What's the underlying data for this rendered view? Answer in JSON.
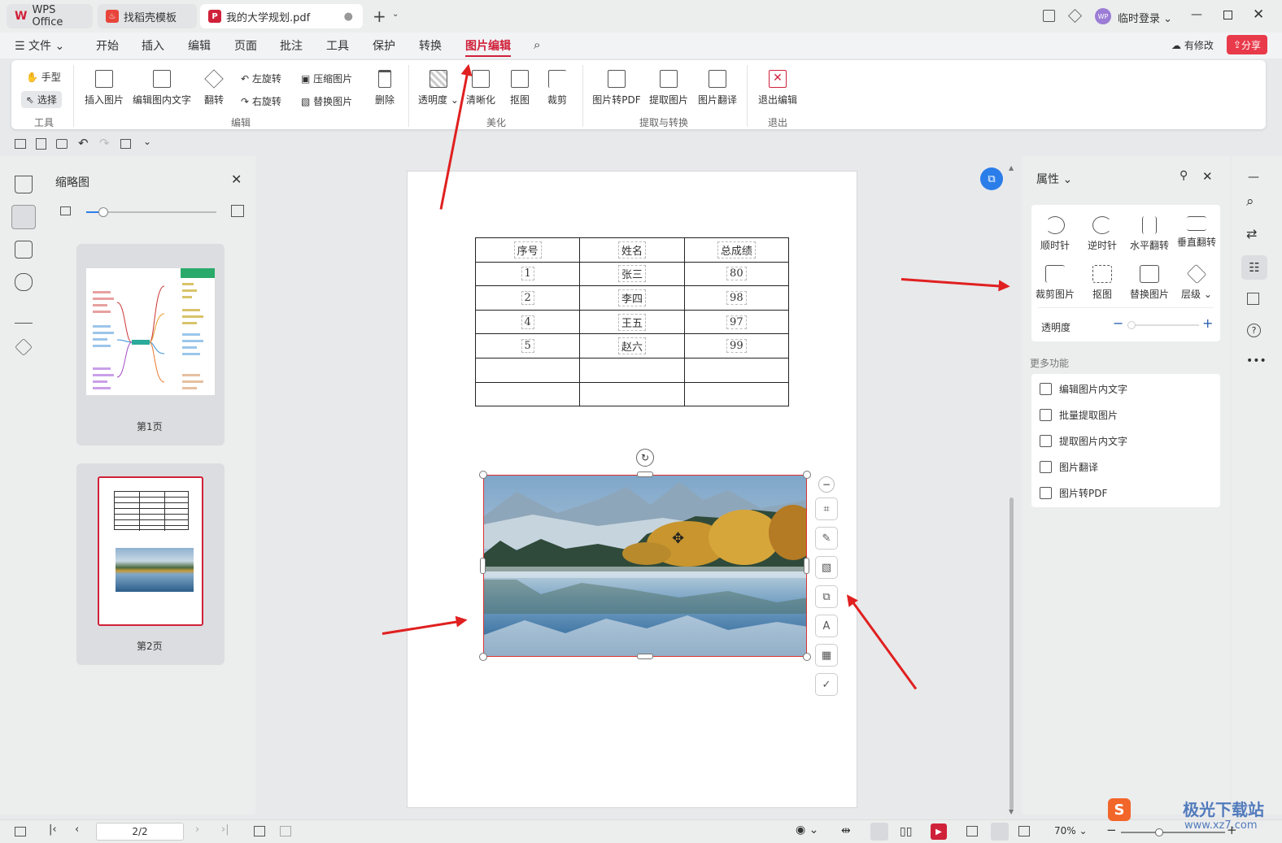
{
  "tabs": {
    "wps": "WPS Office",
    "templates": "找稻壳模板",
    "doc": "我的大学规划.pdf"
  },
  "titlebar": {
    "login": "临时登录",
    "avatar": "WP"
  },
  "menu": {
    "file": "文件",
    "items": [
      "开始",
      "插入",
      "编辑",
      "页面",
      "批注",
      "工具",
      "保护",
      "转换",
      "图片编辑"
    ],
    "modified": "有修改",
    "share": "分享"
  },
  "ribbon": {
    "tools": {
      "hand": "手型",
      "select": "选择",
      "group": "工具"
    },
    "edit": {
      "insert": "插入图片",
      "edit_text": "编辑图内文字",
      "flip": "翻转",
      "rotate_left": "左旋转",
      "rotate_right": "右旋转",
      "compress": "压缩图片",
      "replace": "替换图片",
      "delete": "删除",
      "group": "编辑"
    },
    "beautify": {
      "opacity": "透明度",
      "sharpen": "清晰化",
      "cutout": "抠图",
      "crop": "裁剪",
      "group": "美化"
    },
    "extract": {
      "to_pdf": "图片转PDF",
      "extract": "提取图片",
      "translate": "图片翻译",
      "group": "提取与转换"
    },
    "exit": {
      "label": "退出编辑",
      "group": "退出"
    }
  },
  "thumbnails": {
    "title": "缩略图",
    "pages": [
      "第1页",
      "第2页"
    ]
  },
  "table": {
    "rows": [
      [
        "序号",
        "姓名",
        "总成绩"
      ],
      [
        "1",
        "张三",
        "80"
      ],
      [
        "2",
        "李四",
        "98"
      ],
      [
        "4",
        "王五",
        "97"
      ],
      [
        "5",
        "赵六",
        "99"
      ],
      [
        "",
        "",
        ""
      ],
      [
        "",
        "",
        ""
      ]
    ]
  },
  "properties": {
    "title": "属性",
    "buttons": [
      "顺时针",
      "逆时针",
      "水平翻转",
      "垂直翻转",
      "裁剪图片",
      "抠图",
      "替换图片",
      "层级"
    ],
    "opacity": "透明度",
    "more_title": "更多功能",
    "more": [
      "编辑图片内文字",
      "批量提取图片",
      "提取图片内文字",
      "图片翻译",
      "图片转PDF"
    ]
  },
  "status": {
    "page": "2/2",
    "zoom": "70%"
  },
  "watermark": {
    "text": "极光下载站",
    "url": "www.xz7.com"
  },
  "colors": {
    "accent": "#d0213a",
    "link": "#2b7de9"
  }
}
